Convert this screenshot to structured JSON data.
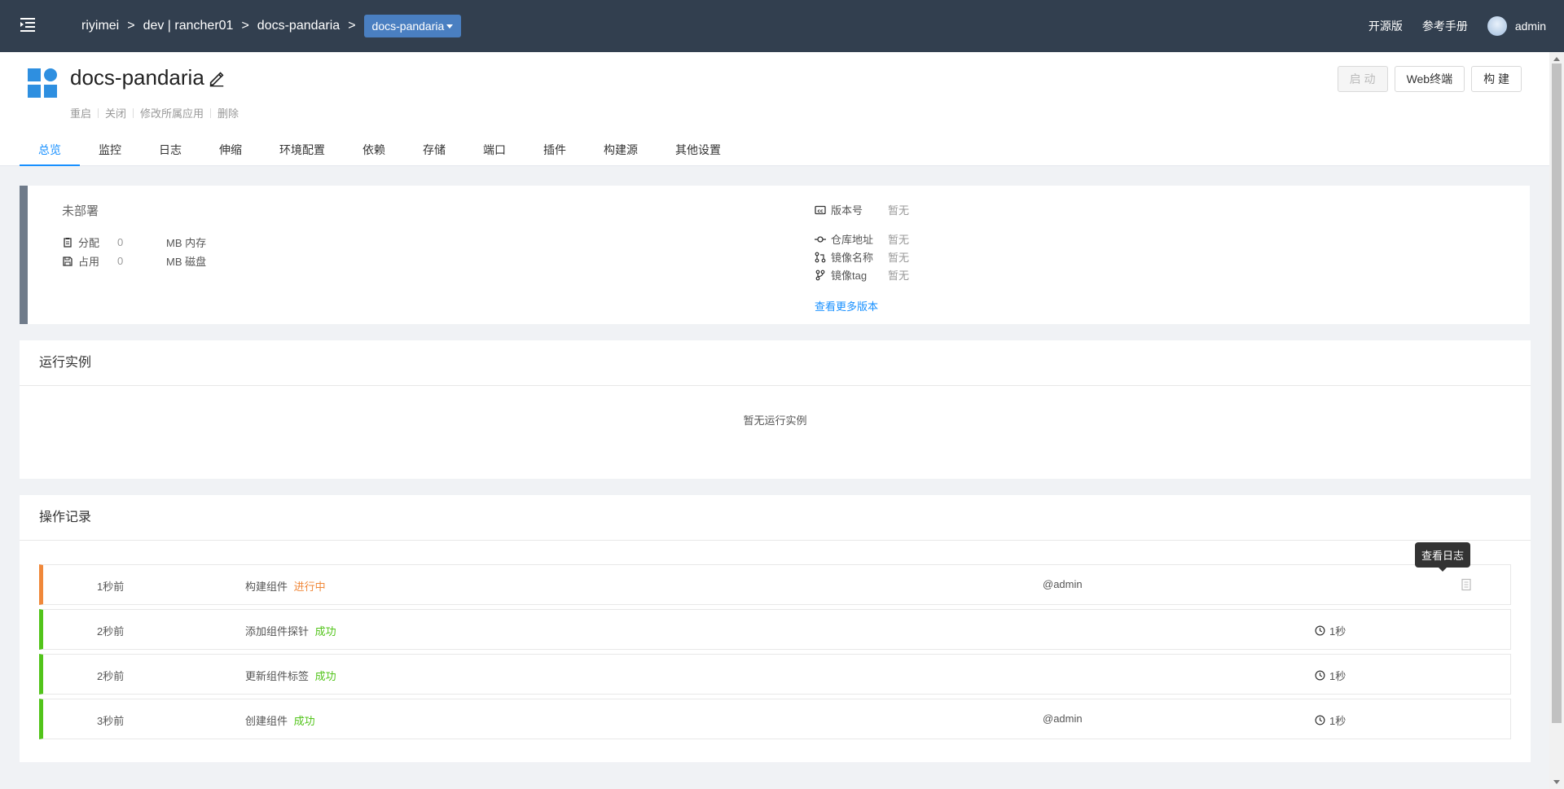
{
  "topbar": {
    "breadcrumb": [
      "riyimei",
      "dev | rancher01",
      "docs-pandaria"
    ],
    "separator": ">",
    "current": "docs-pandaria",
    "links": {
      "opensource": "开源版",
      "manual": "参考手册"
    },
    "user": "admin"
  },
  "header": {
    "title": "docs-pandaria",
    "actions": [
      "重启",
      "关闭",
      "修改所属应用",
      "删除"
    ],
    "buttons": {
      "start": "启 动",
      "terminal": "Web终端",
      "build": "构 建"
    },
    "tabs": [
      "总览",
      "监控",
      "日志",
      "伸缩",
      "环境配置",
      "依赖",
      "存储",
      "端口",
      "插件",
      "构建源",
      "其他设置"
    ],
    "active_tab": "总览"
  },
  "info": {
    "status": "未部署",
    "allocated": {
      "label": "分配",
      "value": "0",
      "unit": "MB 内存"
    },
    "used": {
      "label": "占用",
      "value": "0",
      "unit": "MB 磁盘"
    },
    "version": {
      "label": "版本号",
      "value": "暂无"
    },
    "repo": {
      "label": "仓库地址",
      "value": "暂无"
    },
    "image_name": {
      "label": "镜像名称",
      "value": "暂无"
    },
    "image_tag": {
      "label": "镜像tag",
      "value": "暂无"
    },
    "more_versions": "查看更多版本",
    "status_color": "#6f7b8a"
  },
  "instances": {
    "title": "运行实例",
    "empty": "暂无运行实例"
  },
  "records": {
    "title": "操作记录",
    "tooltip": "查看日志",
    "items": [
      {
        "time": "1秒前",
        "desc": "构建组件",
        "status": "进行中",
        "user": "@admin",
        "duration": ""
      },
      {
        "time": "2秒前",
        "desc": "添加组件探针",
        "status": "成功",
        "user": "",
        "duration": "1秒"
      },
      {
        "time": "2秒前",
        "desc": "更新组件标签",
        "status": "成功",
        "user": "",
        "duration": "1秒"
      },
      {
        "time": "3秒前",
        "desc": "创建组件",
        "status": "成功",
        "user": "@admin",
        "duration": "1秒"
      }
    ],
    "colors": {
      "success": "#52c41a",
      "pending": "#f0883a"
    }
  },
  "icons": {
    "menu": "menu-toggle-icon",
    "edit": "edit-icon",
    "app": "app-grid-icon",
    "version": "cc-icon",
    "repo": "commit-icon",
    "image_name": "pull-request-icon",
    "image_tag": "branch-icon",
    "clock": "clock-icon",
    "log": "log-file-icon"
  }
}
